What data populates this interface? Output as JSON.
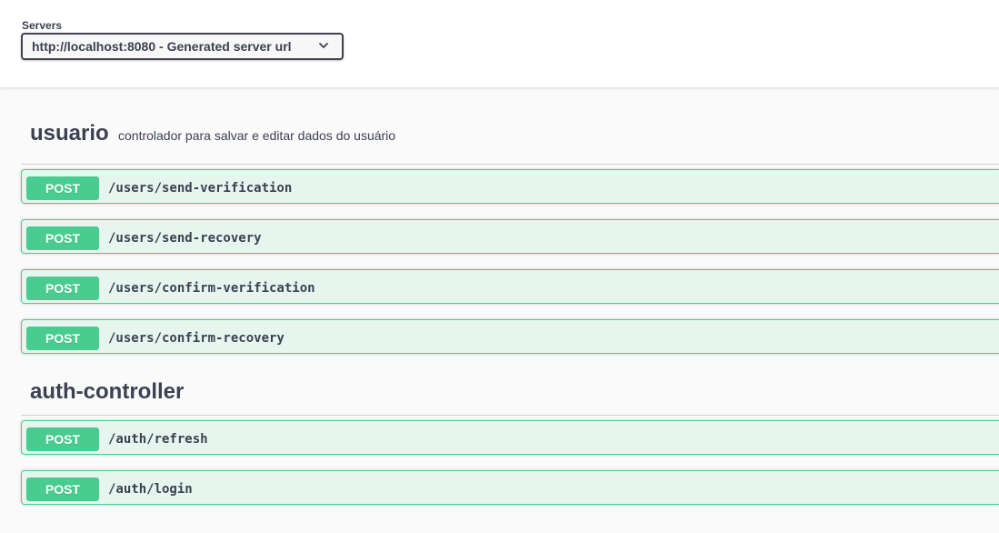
{
  "servers": {
    "label": "Servers",
    "selected": "http://localhost:8080 - Generated server url"
  },
  "tags": [
    {
      "name": "usuario",
      "description": "controlador para salvar e editar dados do usuário",
      "operations": [
        {
          "method": "POST",
          "path": "/users/send-verification"
        },
        {
          "method": "POST",
          "path": "/users/send-recovery"
        },
        {
          "method": "POST",
          "path": "/users/confirm-verification"
        },
        {
          "method": "POST",
          "path": "/users/confirm-recovery"
        }
      ]
    },
    {
      "name": "auth-controller",
      "description": "",
      "operations": [
        {
          "method": "POST",
          "path": "/auth/refresh"
        },
        {
          "method": "POST",
          "path": "/auth/login"
        }
      ]
    }
  ],
  "colors": {
    "post": "#49cc90",
    "post_bg": "#edf8f2",
    "text": "#3b4151"
  }
}
